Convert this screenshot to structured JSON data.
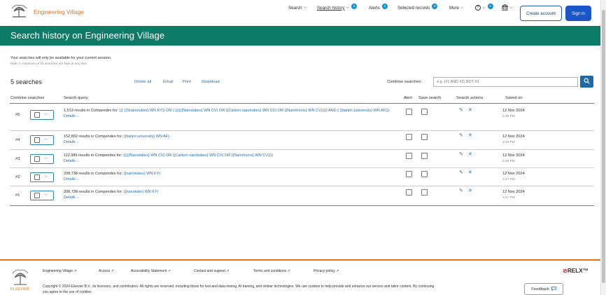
{
  "header": {
    "brand": "Engineering Village",
    "nav": [
      {
        "label": "Search",
        "chevron": "⌵"
      },
      {
        "label": "Search history",
        "chevron": "⌵",
        "badge": "5"
      },
      {
        "label": "Alerts",
        "badge": "0"
      },
      {
        "label": "Selected records",
        "badge": "0"
      },
      {
        "label": "More",
        "chevron": "⌵"
      },
      {
        "label": "?",
        "chevron": "⌵",
        "badge": "4"
      }
    ],
    "create_account": "Create account",
    "sign_in": "Sign in"
  },
  "banner": {
    "title": "Search history on Engineering Village"
  },
  "intro": {
    "text": "Your searches will only be available for your current session.",
    "note": "Note: A maximum of 50 searches are kept at any time."
  },
  "toolbar": {
    "count": "5 searches",
    "delete_all": "Delete all",
    "email": "Email",
    "print": "Print",
    "download": "Download",
    "combine_label": "Combine searches:",
    "combine_placeholder": "e.g. (#1 AND #2) NOT #3"
  },
  "table": {
    "columns": [
      "Combine searches",
      "Search query",
      "Alert",
      "Save search",
      "Search actions",
      "Saved on"
    ],
    "details_label": "Details ⌵",
    "rows": [
      {
        "num": "#5",
        "prefix": "1,513 results in Compendex for: ",
        "query": "((( ({Snanotubes} WN KY)) OR ( ((((({Nanotubes} WN CV) OR ({Carbon nanotubes} WN CV) OR ({Nanohorns} WN CV))))) AND ( ({tianjin {university} WN AF}))",
        "date": "12 Nov 2024",
        "time": "3:49 PM"
      },
      {
        "num": "#4",
        "prefix": "152,802 results in Compendex for: ",
        "query": "({tianjin university} WN AF)",
        "date": "12 Nov 2024",
        "time": "3:49 PM"
      },
      {
        "num": "#3",
        "prefix": "112,389 results in Compendex for: ",
        "query": "(((({Nanotubes} WN CV) OR ({Carbon nanotubes} WN CV) OR ({Nanohorns} WN CV))))",
        "date": "12 Nov 2024",
        "time": "3:48 PM"
      },
      {
        "num": "#2",
        "prefix": "208,738 results in Compendex for: ",
        "query": "({nanotubes} WN KY)",
        "date": "12 Nov 2024",
        "time": "3:47 PM"
      },
      {
        "num": "#1",
        "prefix": "208,738 results in Compendex for: ",
        "query": "({nanotube} WN KY)",
        "date": "12 Nov 2024",
        "time": "3:47 PM"
      }
    ]
  },
  "footer": {
    "links": [
      "Engineering Village ↗",
      "Access ↗",
      "Accessibility Statement ↗",
      "Contact and support ↗",
      "Terms and conditions ↗",
      "Privacy policy ↗"
    ],
    "copyright": "Copyright © 2024 Elsevier B.V., its licensors, and contributors. All rights are reserved, including those for text and data mining, AI training, and similar technologies. We use cookies to help provide and enhance our service and tailor content. By continuing you agree to the use of cookies.",
    "elsevier": "ELSEVIER",
    "relx": "RELX™",
    "feedback": "Feedback"
  },
  "colors": {
    "accent": "#e9711c",
    "banner": "#0d7c66",
    "link": "#1f6fb5",
    "primary_button": "#1a56c7"
  }
}
